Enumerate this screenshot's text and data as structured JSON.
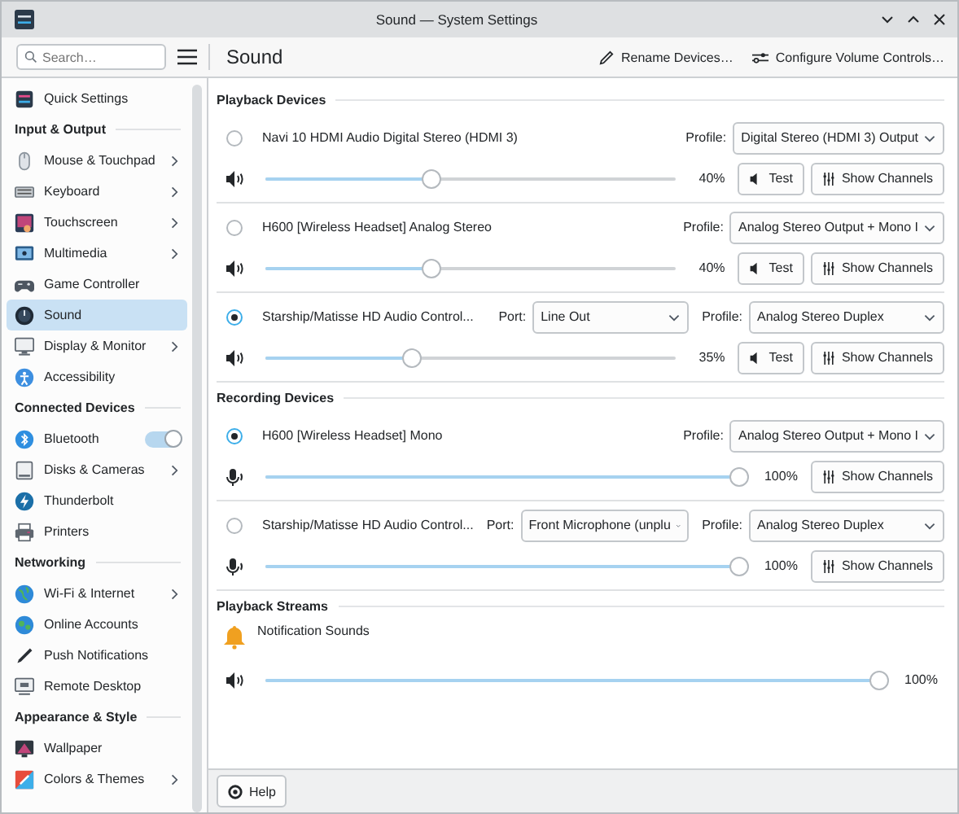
{
  "window": {
    "title": "Sound — System Settings"
  },
  "sidebar": {
    "search": {
      "placeholder": "Search…"
    },
    "items": [
      {
        "kind": "item",
        "label": "Quick Settings",
        "submenu": false,
        "selected": false
      },
      {
        "kind": "header",
        "label": "Input & Output"
      },
      {
        "kind": "item",
        "label": "Mouse & Touchpad",
        "submenu": true,
        "selected": false
      },
      {
        "kind": "item",
        "label": "Keyboard",
        "submenu": true,
        "selected": false
      },
      {
        "kind": "item",
        "label": "Touchscreen",
        "submenu": true,
        "selected": false
      },
      {
        "kind": "item",
        "label": "Multimedia",
        "submenu": true,
        "selected": false
      },
      {
        "kind": "item",
        "label": "Game Controller",
        "submenu": false,
        "selected": false
      },
      {
        "kind": "item",
        "label": "Sound",
        "submenu": false,
        "selected": true
      },
      {
        "kind": "item",
        "label": "Display & Monitor",
        "submenu": true,
        "selected": false
      },
      {
        "kind": "item",
        "label": "Accessibility",
        "submenu": false,
        "selected": false
      },
      {
        "kind": "header",
        "label": "Connected Devices"
      },
      {
        "kind": "toggle",
        "label": "Bluetooth",
        "on": true,
        "selected": false
      },
      {
        "kind": "item",
        "label": "Disks & Cameras",
        "submenu": true,
        "selected": false
      },
      {
        "kind": "item",
        "label": "Thunderbolt",
        "submenu": false,
        "selected": false
      },
      {
        "kind": "item",
        "label": "Printers",
        "submenu": false,
        "selected": false
      },
      {
        "kind": "header",
        "label": "Networking"
      },
      {
        "kind": "item",
        "label": "Wi-Fi & Internet",
        "submenu": true,
        "selected": false
      },
      {
        "kind": "item",
        "label": "Online Accounts",
        "submenu": false,
        "selected": false
      },
      {
        "kind": "item",
        "label": "Push Notifications",
        "submenu": false,
        "selected": false
      },
      {
        "kind": "item",
        "label": "Remote Desktop",
        "submenu": false,
        "selected": false
      },
      {
        "kind": "header",
        "label": "Appearance & Style"
      },
      {
        "kind": "item",
        "label": "Wallpaper",
        "submenu": false,
        "selected": false
      },
      {
        "kind": "item",
        "label": "Colors & Themes",
        "submenu": true,
        "selected": false
      }
    ]
  },
  "page": {
    "title": "Sound",
    "actions": [
      "Rename Devices…",
      "Configure Volume Controls…"
    ]
  },
  "sections": [
    {
      "title": "Playback Devices",
      "kind": "output",
      "devices": [
        {
          "name": "Navi 10 HDMI Audio Digital Stereo (HDMI 3)",
          "selected": false,
          "profile_label": "Profile:",
          "profile": "Digital Stereo (HDMI 3) Output",
          "level": 0.4,
          "reading": "40%",
          "test": "Test",
          "channels": "Show Channels"
        },
        {
          "name": "H600 [Wireless Headset] Analog Stereo",
          "selected": false,
          "profile_label": "Profile:",
          "profile": "Analog Stereo Output + Mono I",
          "level": 0.4,
          "reading": "40%",
          "test": "Test",
          "channels": "Show Channels"
        },
        {
          "name": "Starship/Matisse HD Audio Control...",
          "selected": true,
          "port_label": "Port:",
          "port": "Line Out",
          "profile_label": "Profile:",
          "profile": "Analog Stereo Duplex",
          "level": 0.35,
          "reading": "35%",
          "test": "Test",
          "channels": "Show Channels"
        }
      ]
    },
    {
      "title": "Recording Devices",
      "kind": "input",
      "devices": [
        {
          "name": "H600 [Wireless Headset] Mono",
          "selected": true,
          "profile_label": "Profile:",
          "profile": "Analog Stereo Output + Mono I",
          "level": 1.0,
          "reading": "100%",
          "channels": "Show Channels"
        },
        {
          "name": "Starship/Matisse HD Audio Control...",
          "selected": false,
          "port_label": "Port:",
          "port": "Front Microphone (unplu",
          "profile_label": "Profile:",
          "profile": "Analog Stereo Duplex",
          "level": 1.0,
          "reading": "100%",
          "channels": "Show Channels"
        }
      ]
    },
    {
      "title": "Playback Streams",
      "kind": "stream",
      "streams": [
        {
          "name": "Notification Sounds",
          "level": 1.0,
          "reading": "100%"
        }
      ]
    }
  ],
  "footer": {
    "help": "Help"
  }
}
